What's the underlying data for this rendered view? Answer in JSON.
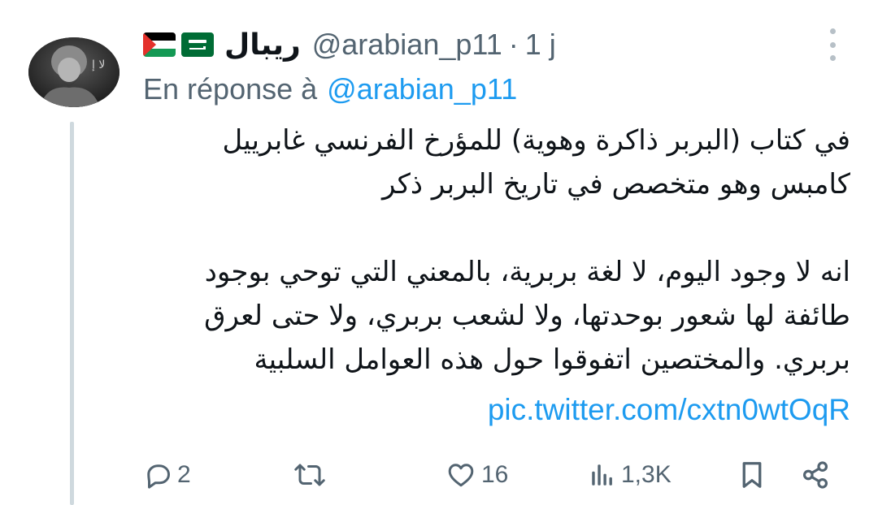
{
  "tweet": {
    "flags": [
      "palestine-flag",
      "saudi-flag"
    ],
    "display_name": "ريبال",
    "handle": "@arabian_p11",
    "separator": "·",
    "time": "1 j",
    "reply_prefix": "En réponse à",
    "reply_handle": "@arabian_p11",
    "text_lines_p1": [
      "في كتاب (البربر ذاكرة وهوية) للمؤرخ الفرنسي غابرييل",
      "كامبس وهو متخصص في تاريخ البربر ذكر"
    ],
    "text_lines_p2": [
      "انه لا وجود اليوم، لا لغة بربرية، بالمعني التي توحي بوجود",
      "طائفة لها شعور بوحدتها، ولا لشعب بربري، ولا حتى لعرق",
      "بربري.  والمختصين اتفوقوا حول هذه العوامل السلبية"
    ],
    "link": "pic.twitter.com/cxtn0wtOqR"
  },
  "actions": {
    "reply_count": "2",
    "retweet_count": "",
    "like_count": "16",
    "views_count": "1,3K"
  },
  "colors": {
    "text": "#0f1419",
    "secondary": "#536471",
    "accent": "#1d9bf0",
    "thread_line": "#cfd9de"
  }
}
